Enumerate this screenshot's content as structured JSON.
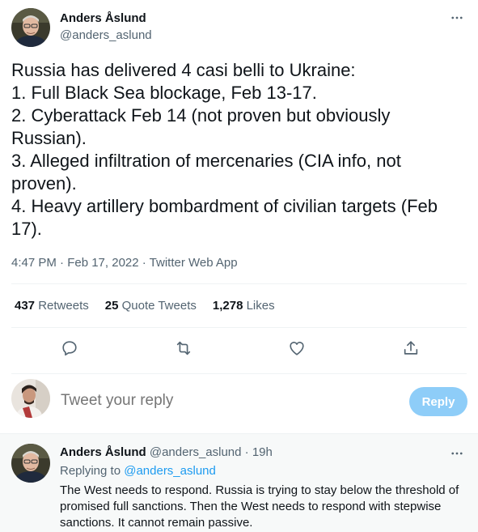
{
  "tweet": {
    "author_name": "Anders Åslund",
    "author_handle": "@anders_aslund",
    "text": "Russia has delivered 4 casi belli to Ukraine:\n1. Full Black Sea blockage, Feb 13-17.\n2. Cyberattack Feb 14 (not proven but obviously Russian).\n3. Alleged infiltration of mercenaries (CIA info, not proven).\n4. Heavy artillery bombardment of civilian targets (Feb 17).",
    "timestamp": "4:47 PM · Feb 17, 2022 · Twitter Web App",
    "stats": {
      "retweets_count": "437",
      "retweets_label": "Retweets",
      "quotes_count": "25",
      "quotes_label": "Quote Tweets",
      "likes_count": "1,278",
      "likes_label": "Likes"
    }
  },
  "reply_box": {
    "placeholder": "Tweet your reply",
    "button_label": "Reply"
  },
  "reply": {
    "author_name": "Anders Åslund",
    "author_handle": "@anders_aslund",
    "separator": "·",
    "time": "19h",
    "replying_label": "Replying to",
    "replying_to": "@anders_aslund",
    "text": "The West needs to respond. Russia is trying to stay below the threshold of promised full sanctions. Then the West needs to respond with stepwise sanctions. It cannot remain passive."
  },
  "colors": {
    "accent": "#1d9bf0",
    "reply_button_disabled": "#8ecdf8",
    "secondary_text": "#536471"
  }
}
